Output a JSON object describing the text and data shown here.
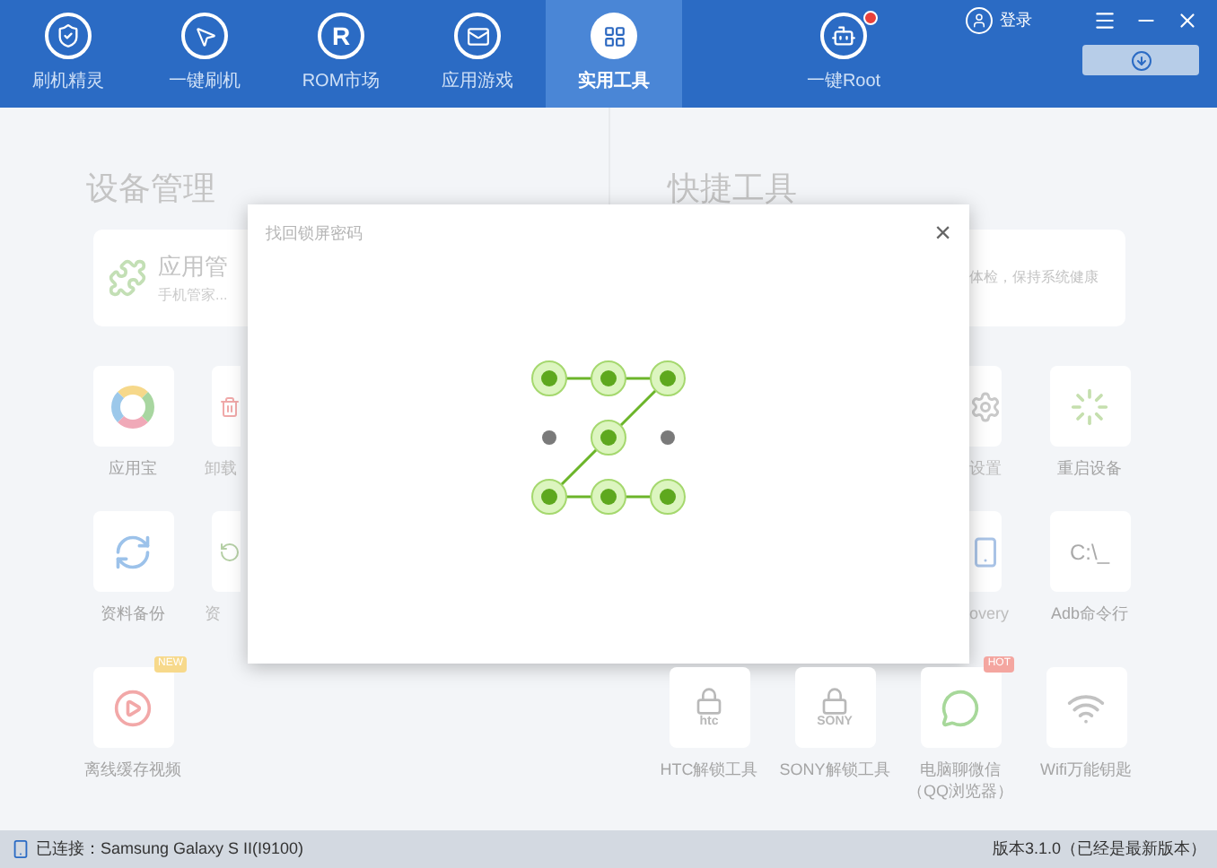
{
  "nav": {
    "tabs": [
      {
        "label": "刷机精灵",
        "kind": "shield",
        "selected": false
      },
      {
        "label": "一键刷机",
        "kind": "cursor",
        "selected": false
      },
      {
        "label": "ROM市场",
        "kind": "letter",
        "glyph": "R",
        "selected": false
      },
      {
        "label": "应用游戏",
        "kind": "mail",
        "selected": false
      },
      {
        "label": "实用工具",
        "kind": "grid",
        "selected": true
      },
      {
        "label": "一键Root",
        "kind": "robot",
        "selected": false,
        "alert": true
      }
    ],
    "login": "登录"
  },
  "device_panel": {
    "title": "设备管理",
    "card": {
      "title": "应用管",
      "subtitle": "手机管家..."
    },
    "tile_rows": [
      {
        "tiles": [
          {
            "kind": "appstore",
            "label": "应用宝"
          },
          {
            "kind": "trash",
            "label": "卸载"
          }
        ]
      },
      {
        "tiles": [
          {
            "kind": "sync",
            "label": "资料备份"
          },
          {
            "kind": "restore",
            "label": "资"
          }
        ]
      }
    ],
    "bottom_tiles": [
      {
        "kind": "video",
        "label": "离线缓存视频",
        "badge": "NEW"
      }
    ]
  },
  "tools_panel": {
    "title": "快捷工具",
    "card": {
      "subtitle": "体检，保持系统健康"
    },
    "tile_rows": [
      {
        "tiles": [
          {
            "kind": "gear",
            "label": "设置"
          },
          {
            "kind": "spinner",
            "label": "重启设备"
          }
        ]
      },
      {
        "tiles": [
          {
            "kind": "phone",
            "label": "overy"
          },
          {
            "kind": "cmd",
            "glyph": "C:\\_",
            "label": "Adb命令行"
          }
        ]
      }
    ],
    "bottom_tiles": [
      {
        "kind": "lock",
        "glyph": "htc",
        "label": "HTC解锁工具"
      },
      {
        "kind": "lock",
        "glyph": "SONY",
        "label": "SONY解锁工具"
      },
      {
        "kind": "chat",
        "label": "电脑聊微信",
        "sublabel": "（QQ浏览器）",
        "badge": "HOT"
      },
      {
        "kind": "wifi",
        "label": "Wifi万能钥匙"
      }
    ]
  },
  "dialog": {
    "title": "找回锁屏密码",
    "close": "×",
    "pattern": {
      "nodes": [
        {
          "selected": true
        },
        {
          "selected": true
        },
        {
          "selected": true
        },
        {
          "selected": false
        },
        {
          "selected": true
        },
        {
          "selected": false
        },
        {
          "selected": true
        },
        {
          "selected": true
        },
        {
          "selected": true
        }
      ]
    }
  },
  "status_bar": {
    "connection": "已连接：Samsung Galaxy S II(I9100)",
    "version": "版本3.1.0（已经是最新版本）"
  }
}
